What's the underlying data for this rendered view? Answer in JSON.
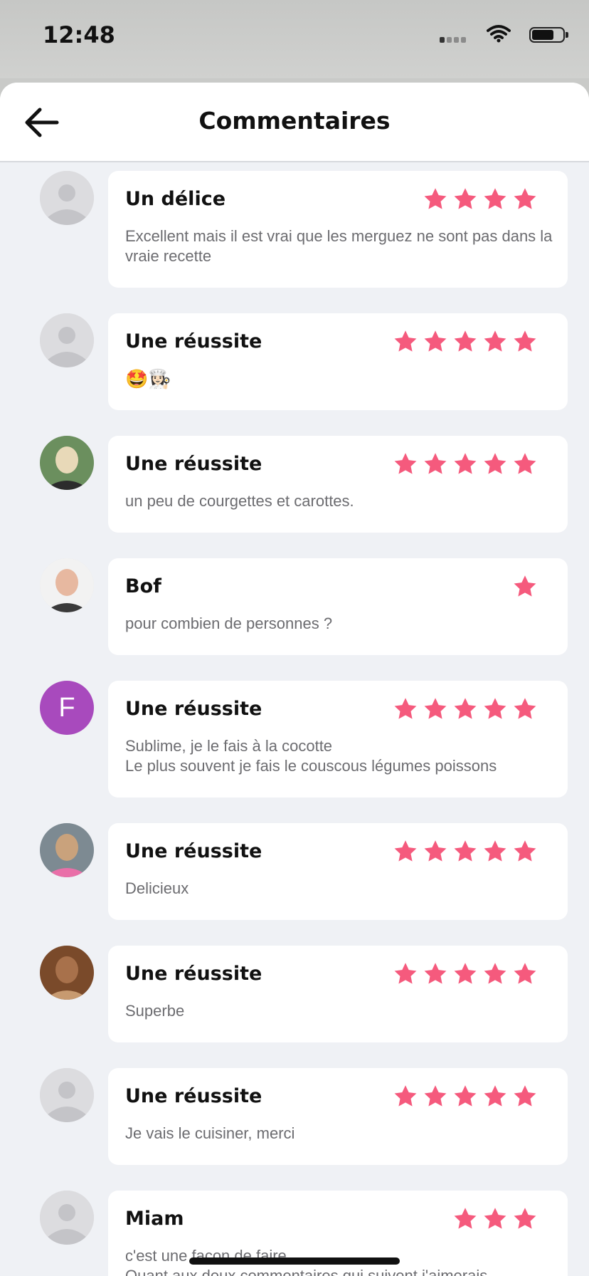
{
  "status_bar": {
    "time": "12:48"
  },
  "header": {
    "title": "Commentaires"
  },
  "colors": {
    "star": "#f55a7d",
    "avatar_letter_bg": "#a84abd"
  },
  "comments": [
    {
      "title": "Un délice",
      "rating": 4,
      "text": "Excellent mais il est vrai que les merguez ne sont pas dans la vraie recette",
      "avatar": "default-avatar-icon"
    },
    {
      "title": "Une réussite",
      "rating": 5,
      "text": "🤩👩🏻‍🍳",
      "avatar": "default-avatar-icon"
    },
    {
      "title": "Une réussite",
      "rating": 5,
      "text": "un peu de courgettes et carottes.",
      "avatar": "user-photo"
    },
    {
      "title": "Bof",
      "rating": 1,
      "text": "pour combien de personnes ?",
      "avatar": "user-photo"
    },
    {
      "title": "Une réussite",
      "rating": 5,
      "text": "Sublime, je le fais à la cocotte\nLe plus souvent je fais le couscous légumes poissons",
      "avatar": "letter",
      "avatar_letter": "F"
    },
    {
      "title": "Une réussite",
      "rating": 5,
      "text": "Delicieux",
      "avatar": "user-photo"
    },
    {
      "title": "Une réussite",
      "rating": 5,
      "text": "Superbe",
      "avatar": "user-photo"
    },
    {
      "title": "Une réussite",
      "rating": 5,
      "text": "Je vais le cuisiner, merci",
      "avatar": "default-avatar-icon"
    },
    {
      "title": "Miam",
      "rating": 3,
      "text": "c'est une façon de faire.\nQuant aux deux commentaires qui suivent j'aimerais",
      "avatar": "default-avatar-icon"
    }
  ]
}
